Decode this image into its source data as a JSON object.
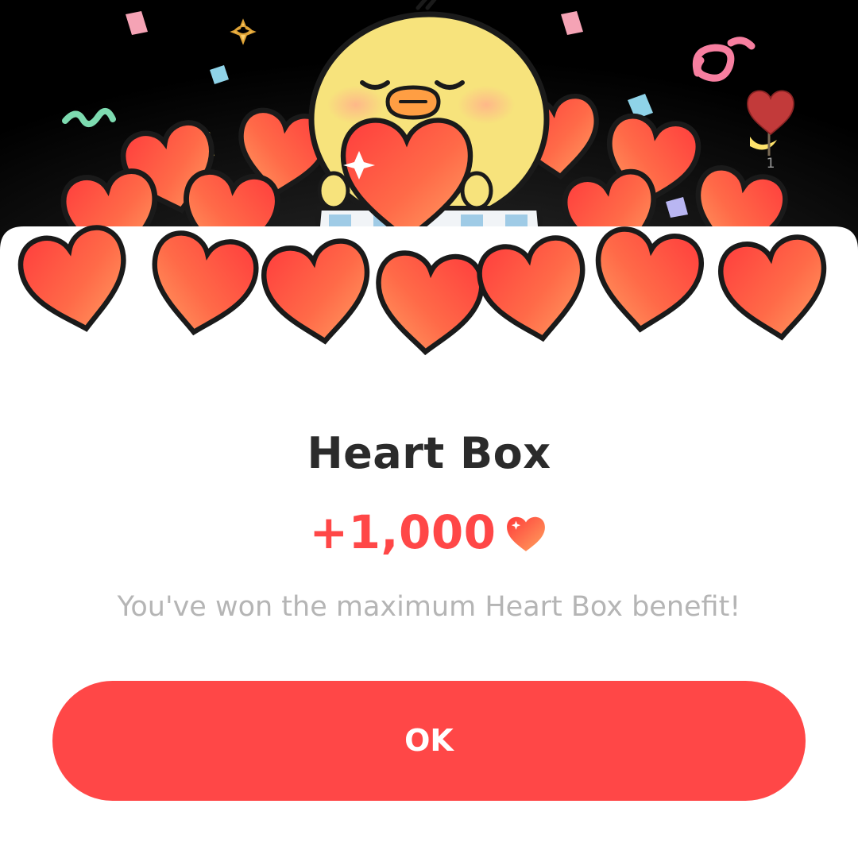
{
  "dialog": {
    "title": "Heart Box",
    "reward_amount": "+1,000",
    "reward_icon": "heart-icon",
    "message": "You've won the maximum Heart Box benefit!",
    "ok_label": "OK"
  },
  "illustration": {
    "subject": "chick-mascot-holding-heart",
    "badge_count": "1"
  },
  "colors": {
    "accent": "#ff4747",
    "title_text": "#2b2b2b",
    "message_text": "#b5b5b5",
    "heart_light": "#ff8a5c",
    "heart_dark": "#ff4040",
    "mascot": "#f7e37c"
  }
}
